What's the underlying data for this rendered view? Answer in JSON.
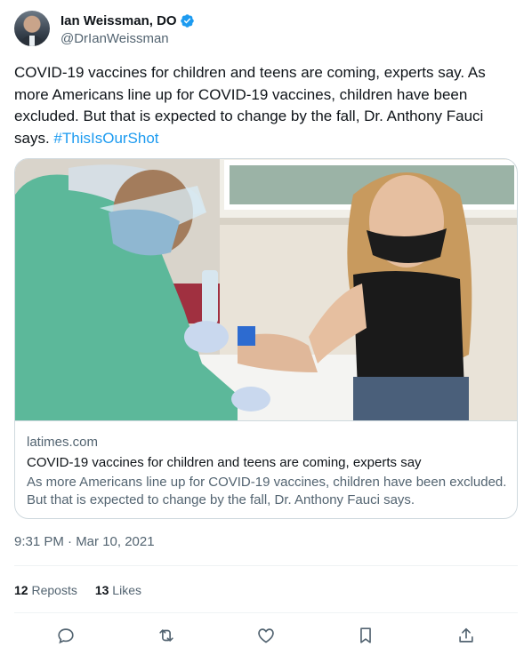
{
  "author": {
    "display_name": "Ian Weissman, DO",
    "handle": "@DrIanWeissman",
    "verified": true
  },
  "tweet": {
    "text": "COVID-19 vaccines for children and teens are coming, experts say. As more Americans line up for COVID-19 vaccines, children have been excluded. But that is expected to change by the fall, Dr. Anthony Fauci says.",
    "hashtag": "#ThisIsOurShot"
  },
  "card": {
    "domain": "latimes.com",
    "title": "COVID-19 vaccines for children and teens are coming, experts say",
    "description": "As more Americans line up for COVID-19 vaccines, children have been excluded. But that is expected to change by the fall, Dr. Anthony Fauci says."
  },
  "meta": {
    "timestamp": "9:31 PM · Mar 10, 2021"
  },
  "stats": {
    "reposts_count": "12",
    "reposts_label": "Reposts",
    "likes_count": "13",
    "likes_label": "Likes"
  },
  "actions": [
    {
      "icon": "reply-icon"
    },
    {
      "icon": "repost-icon"
    },
    {
      "icon": "like-icon"
    },
    {
      "icon": "bookmark-icon"
    },
    {
      "icon": "share-icon"
    }
  ],
  "colors": {
    "accent": "#1d9bf0",
    "text": "#0f1419",
    "secondary": "#536471",
    "border": "#cfd9de"
  }
}
